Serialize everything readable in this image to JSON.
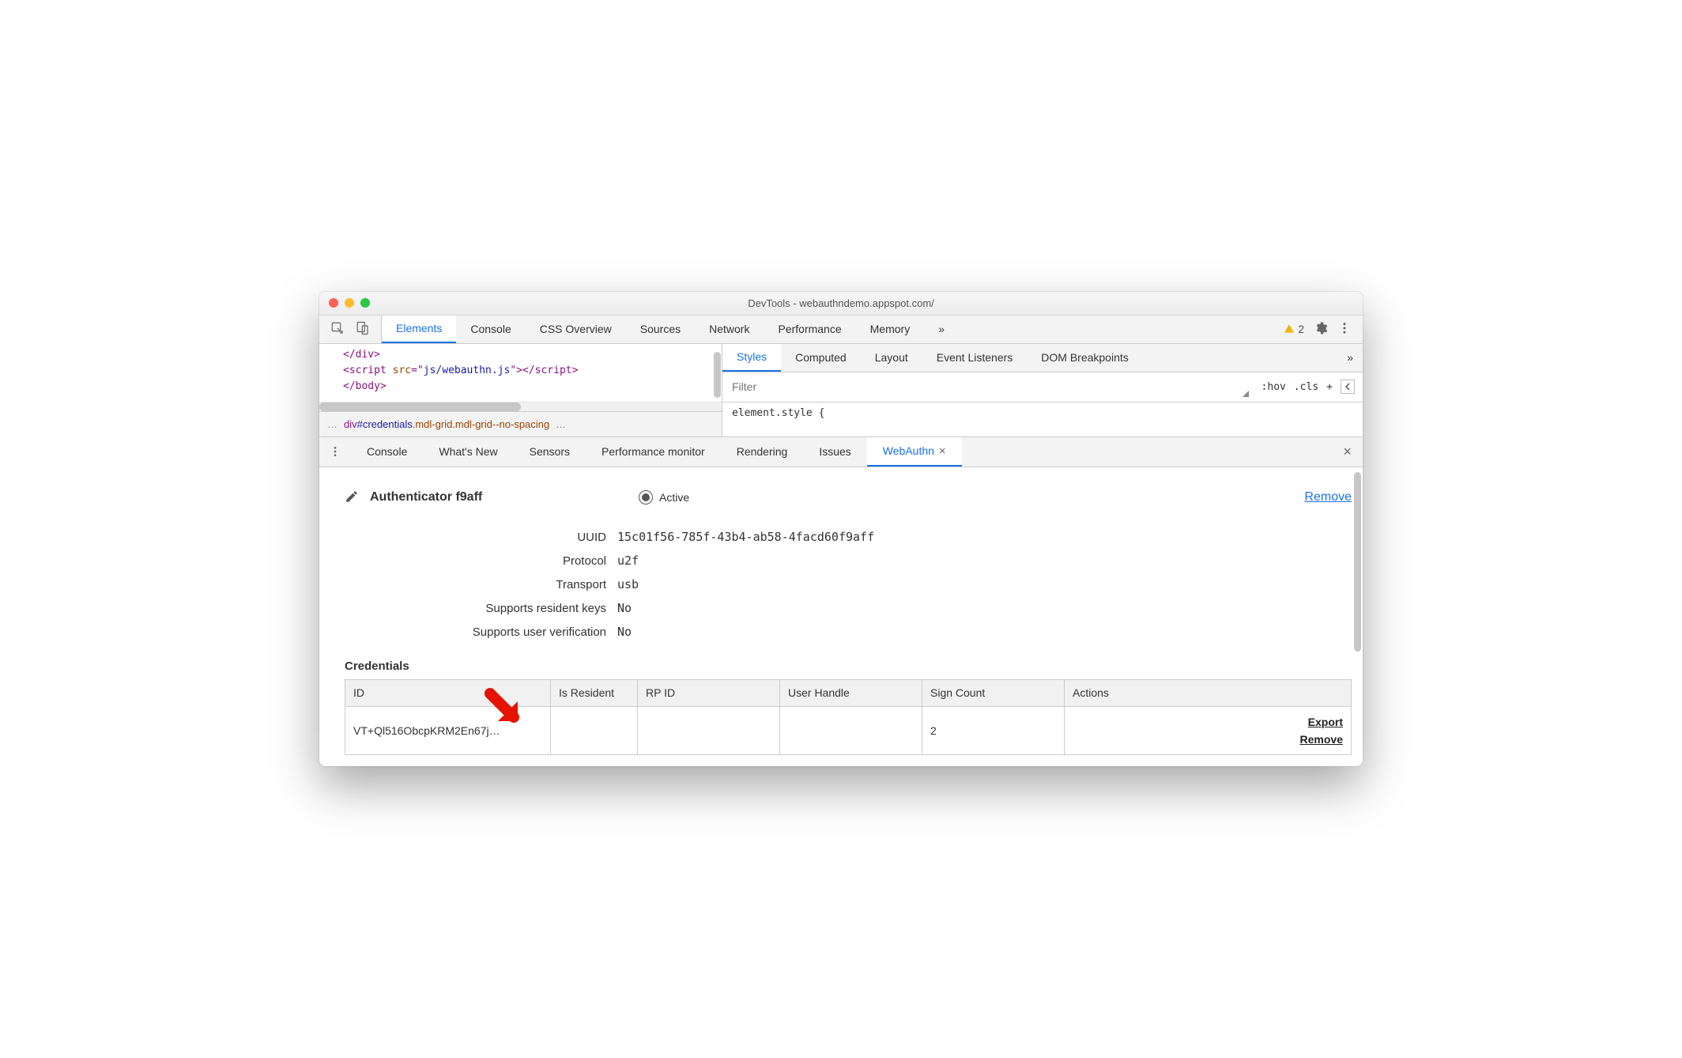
{
  "window": {
    "title": "DevTools - webauthndemo.appspot.com/"
  },
  "main_tabs": {
    "items": [
      "Elements",
      "Console",
      "CSS Overview",
      "Sources",
      "Network",
      "Performance",
      "Memory"
    ],
    "active": 0,
    "overflow": "»",
    "warning_count": "2"
  },
  "code": {
    "l1": "</div>",
    "l2a": "<script ",
    "l2b": "src",
    "l2c": "=\"",
    "l2d": "js/webauthn.js",
    "l2e": "\">",
    "l2f": "</script>",
    "l3": "</body>"
  },
  "crumb": {
    "ell1": "…",
    "tag": "div",
    "id": "#credentials",
    "cls": ".mdl-grid.mdl-grid--no-spacing",
    "ell2": "…"
  },
  "styles": {
    "tabs": [
      "Styles",
      "Computed",
      "Layout",
      "Event Listeners",
      "DOM Breakpoints"
    ],
    "active": 0,
    "overflow": "»",
    "filter_placeholder": "Filter",
    "hov": ":hov",
    "cls": ".cls",
    "plus": "+",
    "element_style": "element.style {"
  },
  "drawer": {
    "tabs": [
      "Console",
      "What's New",
      "Sensors",
      "Performance monitor",
      "Rendering",
      "Issues",
      "WebAuthn"
    ],
    "active": 6
  },
  "webauthn": {
    "header_name": "Authenticator f9aff",
    "active_label": "Active",
    "remove_label": "Remove",
    "props": [
      {
        "label": "UUID",
        "value": "15c01f56-785f-43b4-ab58-4facd60f9aff"
      },
      {
        "label": "Protocol",
        "value": "u2f"
      },
      {
        "label": "Transport",
        "value": "usb"
      },
      {
        "label": "Supports resident keys",
        "value": "No"
      },
      {
        "label": "Supports user verification",
        "value": "No"
      }
    ],
    "credentials_title": "Credentials",
    "columns": [
      "ID",
      "Is Resident",
      "RP ID",
      "User Handle",
      "Sign Count",
      "Actions"
    ],
    "row": {
      "id": "VT+Ql516ObcpKRM2En67j…",
      "is_resident": "",
      "rp_id": "",
      "user_handle": "",
      "sign_count": "2"
    },
    "export": "Export",
    "remove_row": "Remove"
  }
}
